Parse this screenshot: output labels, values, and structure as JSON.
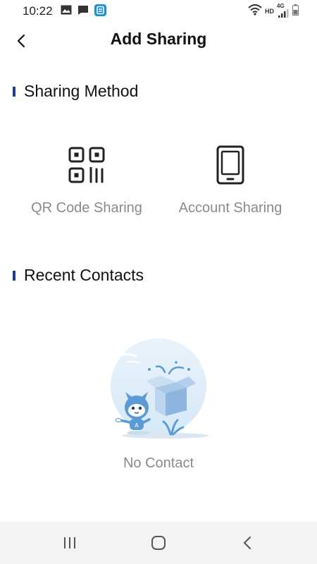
{
  "status_bar": {
    "time": "10:22",
    "network_label": "HD",
    "network_type": "4G",
    "icons": [
      "image-icon",
      "message-icon",
      "app-badge-icon",
      "wifi-icon",
      "signal-icon",
      "battery-icon"
    ]
  },
  "header": {
    "title": "Add Sharing",
    "back_icon": "chevron-left-icon"
  },
  "sharing_method": {
    "section_title": "Sharing Method",
    "options": [
      {
        "label": "QR Code Sharing",
        "icon": "qr-code-icon"
      },
      {
        "label": "Account Sharing",
        "icon": "phone-icon"
      }
    ]
  },
  "recent_contacts": {
    "section_title": "Recent Contacts",
    "empty_text": "No Contact"
  },
  "nav_bar": {
    "buttons": [
      "recents-icon",
      "home-icon",
      "back-icon"
    ]
  },
  "colors": {
    "section_accent": "#1f3f8a",
    "muted_text": "#8a8a8a",
    "illustration_blue": "#5b9bd5",
    "nav_background": "#f3f3f3"
  }
}
